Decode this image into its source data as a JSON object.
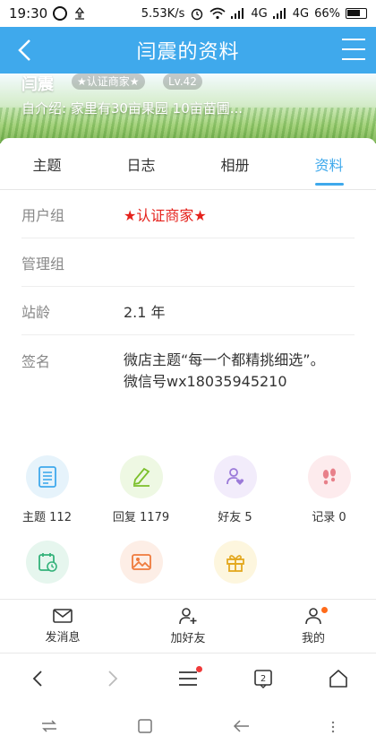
{
  "status": {
    "time": "19:30",
    "speed": "5.53K/s",
    "net1": "4G",
    "net2": "4G",
    "battery": "66%"
  },
  "nav": {
    "title": "闫震的资料"
  },
  "banner": {
    "name": "闫震",
    "badge": "★认证商家★",
    "level": "Lv.42",
    "intro": "自介绍: 家里有30亩果园 10亩苗圃..."
  },
  "tabs": [
    {
      "label": "主题"
    },
    {
      "label": "日志"
    },
    {
      "label": "相册"
    },
    {
      "label": "资料"
    }
  ],
  "info": {
    "usergroup": {
      "key": "用户组",
      "value": "★认证商家★"
    },
    "admingroup": {
      "key": "管理组",
      "value": ""
    },
    "age": {
      "key": "站龄",
      "value": "2.1 年"
    },
    "signature": {
      "key": "签名",
      "line1": "微店主题“每一个都精挑细选”。",
      "line2": "微信号wx18035945210"
    }
  },
  "stats": [
    {
      "label": "主题 112",
      "icon": "document-icon",
      "color": "#e6f3fb"
    },
    {
      "label": "回复 1179",
      "icon": "pencil-icon",
      "color": "#eef8e3"
    },
    {
      "label": "好友 5",
      "icon": "friend-heart-icon",
      "color": "#f2ecfb"
    },
    {
      "label": "记录 0",
      "icon": "footprints-icon",
      "color": "#fdebed"
    }
  ],
  "stats2": [
    {
      "icon": "calendar-clock-icon",
      "color": "#e6f6ee"
    },
    {
      "icon": "picture-icon",
      "color": "#fdeee6"
    },
    {
      "icon": "gift-icon",
      "color": "#fdf6de"
    }
  ],
  "actions": {
    "message": "发消息",
    "add_friend": "加好友",
    "mine": "我的"
  },
  "colors": {
    "accent": "#3fa9ec",
    "red": "#e5221c",
    "orange_dot": "#ff6b1a"
  }
}
